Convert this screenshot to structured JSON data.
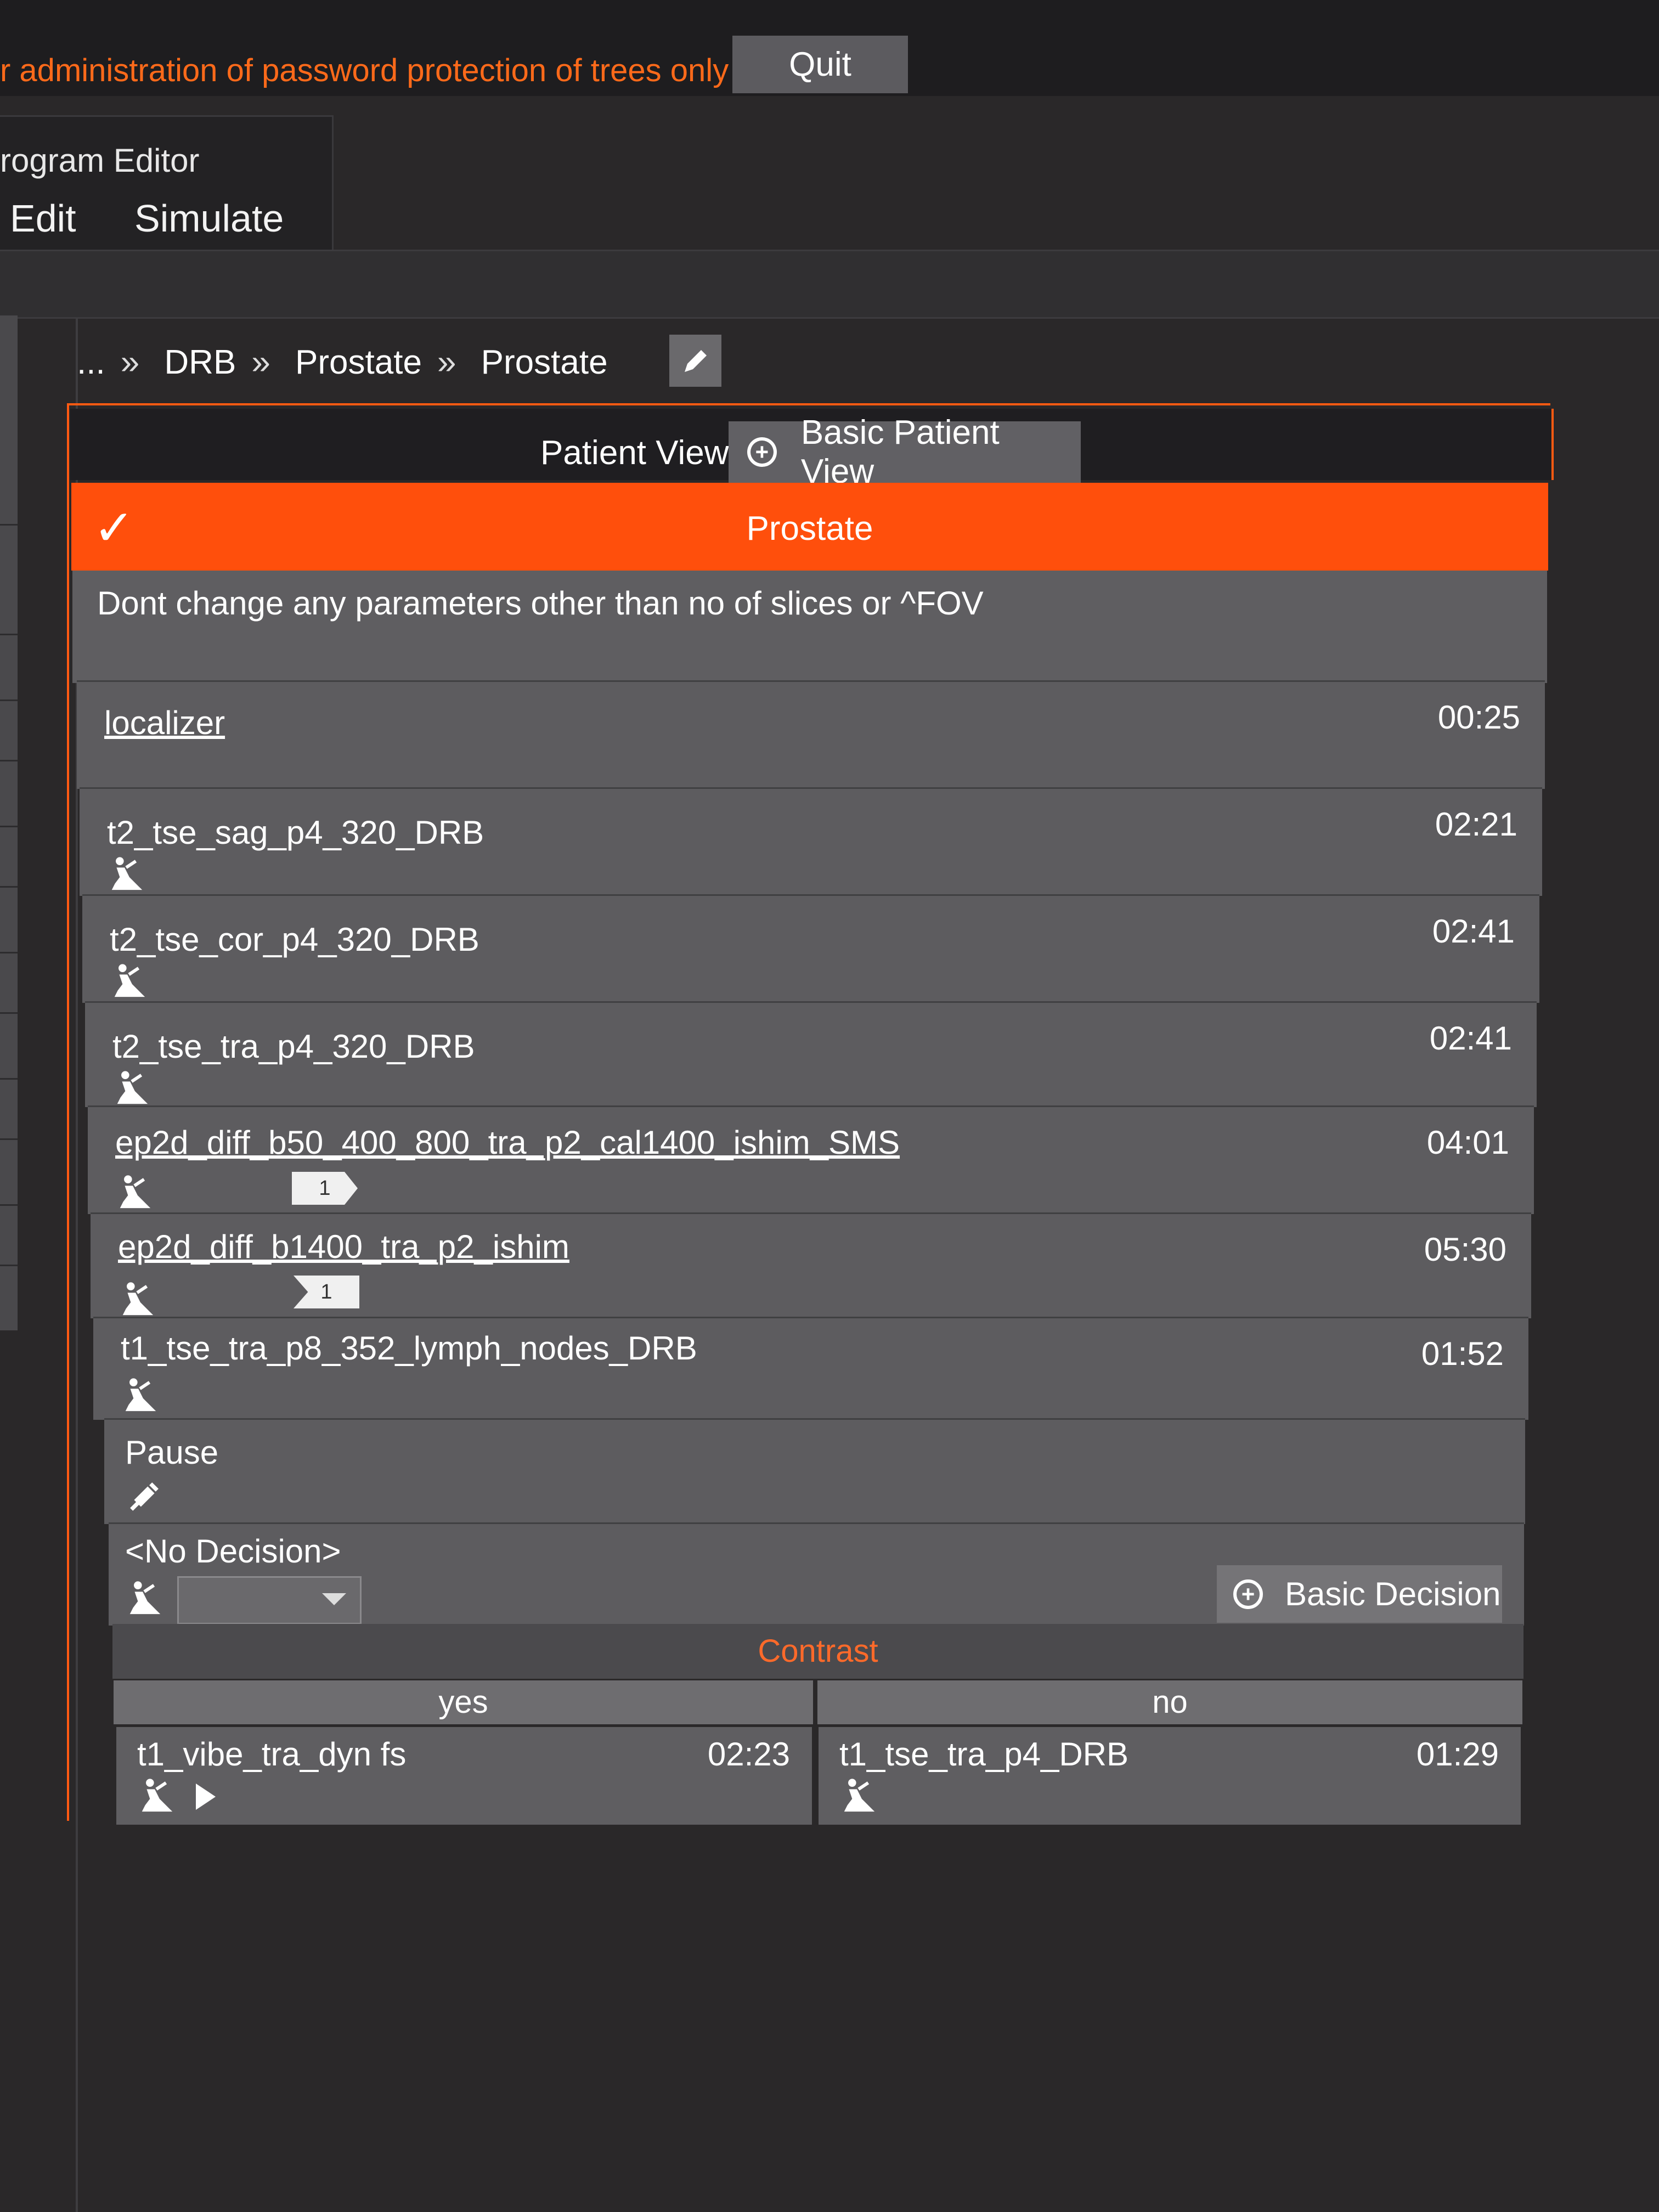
{
  "topbar": {
    "admin_text": "r administration of password protection of trees only",
    "quit_label": "Quit"
  },
  "menu": {
    "title": "rogram Editor",
    "items": [
      "Edit",
      "Simulate"
    ]
  },
  "breadcrumb": [
    "...",
    "DRB",
    "Prostate",
    "Prostate"
  ],
  "breadcrumb_sep": "»",
  "patient_view": {
    "label": "Patient View",
    "button_label": "Basic Patient View"
  },
  "program": {
    "name": "Prostate",
    "note": "Dont change any parameters other than no of slices or ^FOV"
  },
  "protocols": [
    {
      "name": "localizer",
      "duration": "00:25"
    },
    {
      "name": "t2_tse_sag_p4_320_DRB",
      "duration": "02:21"
    },
    {
      "name": "t2_tse_cor_p4_320_DRB",
      "duration": "02:41"
    },
    {
      "name": "t2_tse_tra_p4_320_DRB",
      "duration": "02:41"
    },
    {
      "name": "ep2d_diff_b50_400_800_tra_p2_cal1400_ishim_SMS",
      "duration": "04:01",
      "tag": "1"
    },
    {
      "name": "ep2d_diff_b1400_tra_p2_ishim",
      "duration": "05:30",
      "tag": "1"
    },
    {
      "name": "t1_tse_tra_p8_352_lymph_nodes_DRB",
      "duration": "01:52"
    },
    {
      "name": "Pause"
    }
  ],
  "decision": {
    "label": "<No Decision>",
    "button_label": "Basic Decision",
    "contrast_label": "Contrast",
    "branches": [
      {
        "head": "yes",
        "name": "t1_vibe_tra_dyn fs",
        "duration": "02:23"
      },
      {
        "head": "no",
        "name": "t1_tse_tra_p4_DRB",
        "duration": "01:29"
      }
    ]
  }
}
